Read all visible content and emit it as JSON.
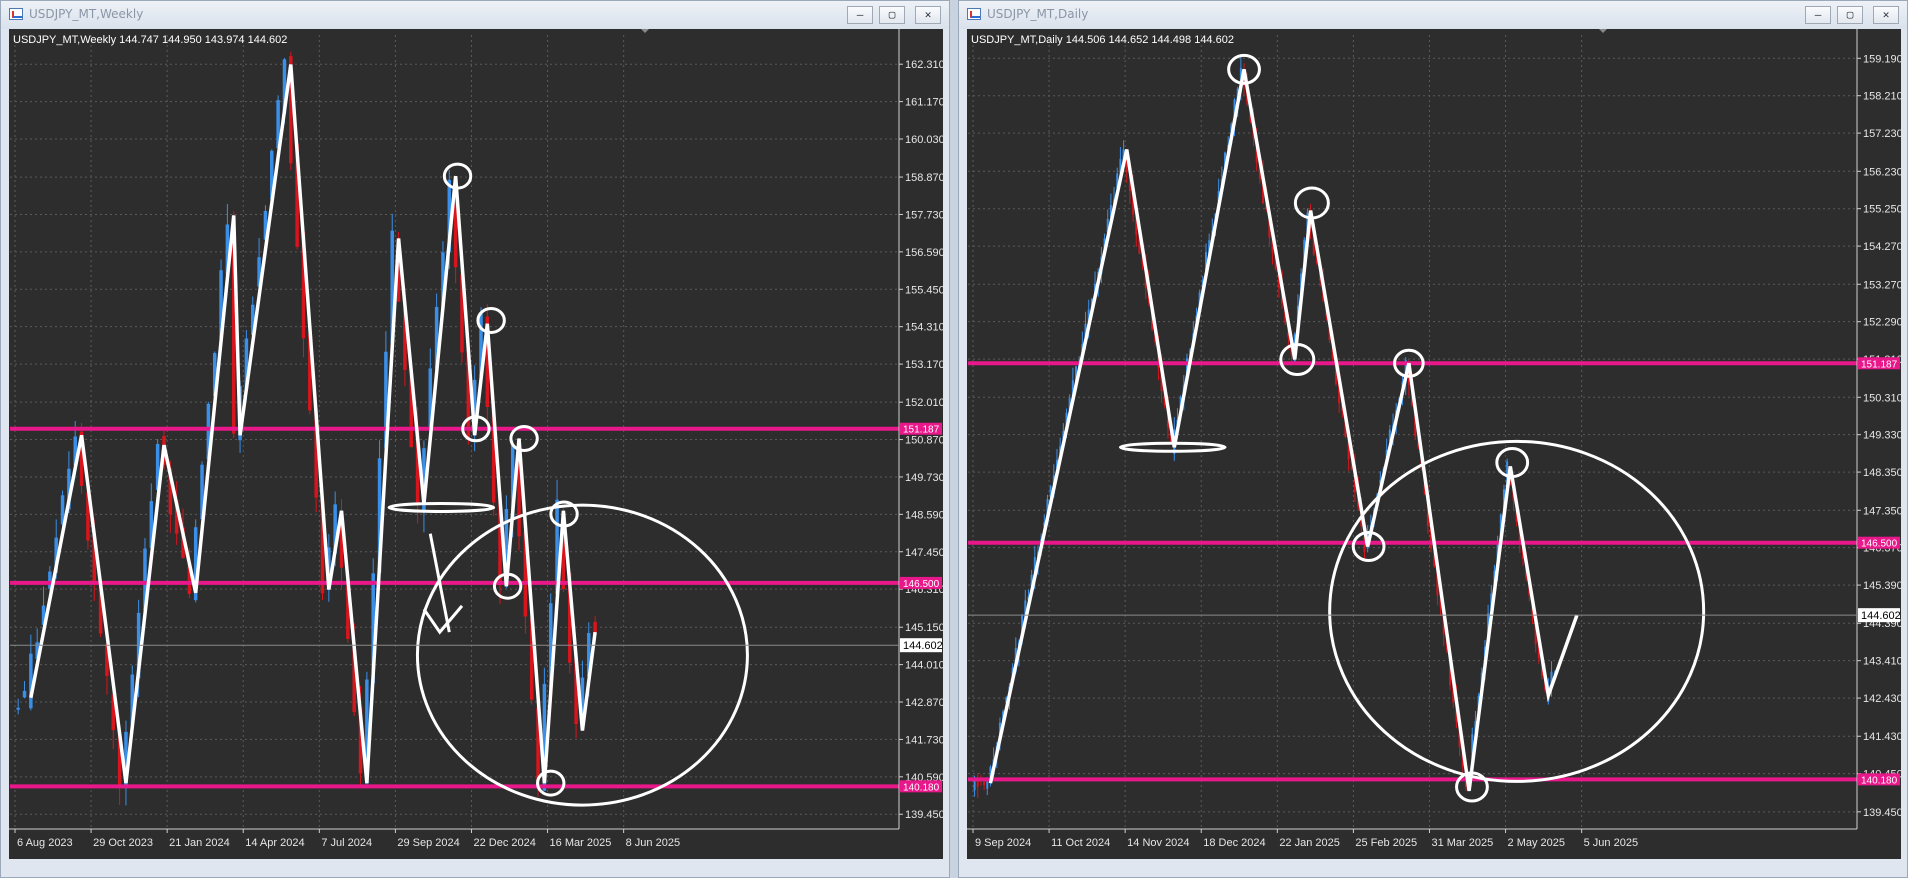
{
  "windows": [
    {
      "id": "weekly",
      "title": "USDJPY_MT,Weekly",
      "info": "USDJPY_MT,Weekly  144.747 144.950 143.974 144.602",
      "buttons": {
        "minimize": "—",
        "maximize": "▢",
        "close": "✕"
      }
    },
    {
      "id": "daily",
      "title": "USDJPY_MT,Daily",
      "info": "USDJPY_MT,Daily  144.506 144.652 144.498 144.602",
      "buttons": {
        "minimize": "—",
        "maximize": "▢",
        "close": "✕"
      }
    }
  ],
  "chart_data": [
    {
      "type": "candlestick",
      "symbol": "USDJPY_MT",
      "timeframe": "Weekly",
      "ylim": [
        139.0,
        163.2
      ],
      "y_ticks": [
        "162.310",
        "161.170",
        "160.030",
        "158.870",
        "157.730",
        "156.590",
        "155.450",
        "154.310",
        "153.170",
        "152.010",
        "150.870",
        "149.730",
        "148.590",
        "147.450",
        "146.310",
        "145.150",
        "144.010",
        "142.870",
        "141.730",
        "140.590",
        "139.450"
      ],
      "x_ticks": [
        "6 Aug 2023",
        "29 Oct 2023",
        "21 Jan 2024",
        "14 Apr 2024",
        "7 Jul 2024",
        "29 Sep 2024",
        "22 Dec 2024",
        "16 Mar 2025",
        "8 Jun 2025"
      ],
      "x_tick_index": [
        0,
        12,
        24,
        36,
        48,
        60,
        72,
        84,
        96
      ],
      "bars": 100,
      "current_price": "144.602",
      "horizontal_levels": [
        {
          "price": 151.2,
          "label": "151.187"
        },
        {
          "price": 146.5,
          "label": "146.500"
        },
        {
          "price": 140.3,
          "label": "140.180"
        }
      ],
      "path": [
        [
          2,
          143
        ],
        [
          10,
          151
        ],
        [
          17,
          140.4
        ],
        [
          23,
          150.7
        ],
        [
          28,
          146.2
        ],
        [
          34,
          157.7
        ],
        [
          35,
          151
        ],
        [
          43,
          162.3
        ],
        [
          49,
          146.3
        ],
        [
          51,
          148.7
        ],
        [
          55,
          140.4
        ],
        [
          60,
          157
        ],
        [
          64,
          148.9
        ],
        [
          69,
          158.9
        ],
        [
          72,
          151
        ],
        [
          74,
          154.4
        ],
        [
          77,
          146.4
        ],
        [
          79,
          150.9
        ],
        [
          83,
          140.4
        ],
        [
          86,
          148.7
        ],
        [
          89,
          142
        ],
        [
          91,
          145
        ]
      ],
      "circles": [
        {
          "x": 69.3,
          "y": 158.9,
          "r": 12
        },
        {
          "x": 74.6,
          "y": 154.5,
          "r": 12
        },
        {
          "x": 72.2,
          "y": 151.2,
          "r": 12
        },
        {
          "x": 79.8,
          "y": 150.9,
          "r": 12
        },
        {
          "x": 77.2,
          "y": 146.4,
          "r": 12
        },
        {
          "x": 86.1,
          "y": 148.6,
          "r": 12
        },
        {
          "x": 84.0,
          "y": 140.4,
          "r": 12
        },
        {
          "x": 89.0,
          "y": 144.3,
          "r": 150
        }
      ],
      "strokes": [
        [
          [
            58.5,
            148.8
          ],
          [
            75,
            148.8
          ]
        ],
        [
          [
            65,
            148.0
          ],
          [
            68,
            145
          ]
        ],
        [
          [
            64,
            145.7
          ],
          [
            66.5,
            145
          ],
          [
            70,
            145.8
          ]
        ]
      ]
    },
    {
      "type": "candlestick",
      "symbol": "USDJPY_MT",
      "timeframe": "Daily",
      "ylim": [
        139.0,
        159.8
      ],
      "y_ticks": [
        "159.190",
        "158.210",
        "157.230",
        "156.230",
        "155.250",
        "154.270",
        "153.270",
        "152.290",
        "151.310",
        "150.310",
        "149.330",
        "148.350",
        "147.350",
        "146.370",
        "145.390",
        "144.390",
        "143.410",
        "142.430",
        "141.430",
        "140.450",
        "139.450"
      ],
      "x_ticks": [
        "9 Sep 2024",
        "11 Oct 2024",
        "14 Nov 2024",
        "18 Dec 2024",
        "22 Jan 2025",
        "25 Feb 2025",
        "31 Mar 2025",
        "2 May 2025",
        "5 Jun 2025"
      ],
      "x_tick_index": [
        0,
        24,
        48,
        72,
        96,
        120,
        144,
        168,
        192
      ],
      "bars": 200,
      "current_price": "144.602",
      "horizontal_levels": [
        {
          "price": 151.2,
          "label": "151.187"
        },
        {
          "price": 146.5,
          "label": "146.500"
        },
        {
          "price": 140.3,
          "label": "140.180"
        }
      ],
      "path": [
        [
          5,
          140.2
        ],
        [
          48,
          156.8
        ],
        [
          63,
          149
        ],
        [
          85,
          158.9
        ],
        [
          101,
          151.3
        ],
        [
          106,
          155.2
        ],
        [
          124,
          146.4
        ],
        [
          137,
          151.2
        ],
        [
          156,
          140
        ],
        [
          169,
          148.5
        ],
        [
          181,
          142.5
        ],
        [
          190,
          144.6
        ]
      ],
      "circles": [
        {
          "x": 85.0,
          "y": 158.9,
          "r": 14
        },
        {
          "x": 106.4,
          "y": 155.4,
          "r": 15
        },
        {
          "x": 101.8,
          "y": 151.3,
          "r": 15
        },
        {
          "x": 137.0,
          "y": 151.2,
          "r": 13
        },
        {
          "x": 124.3,
          "y": 146.4,
          "r": 14
        },
        {
          "x": 169.6,
          "y": 148.6,
          "r": 14
        },
        {
          "x": 156.9,
          "y": 140.1,
          "r": 14
        },
        {
          "x": 171.0,
          "y": 144.7,
          "r": 170
        }
      ],
      "strokes": [
        [
          [
            46,
            149.0
          ],
          [
            79,
            149.0
          ]
        ]
      ]
    }
  ]
}
